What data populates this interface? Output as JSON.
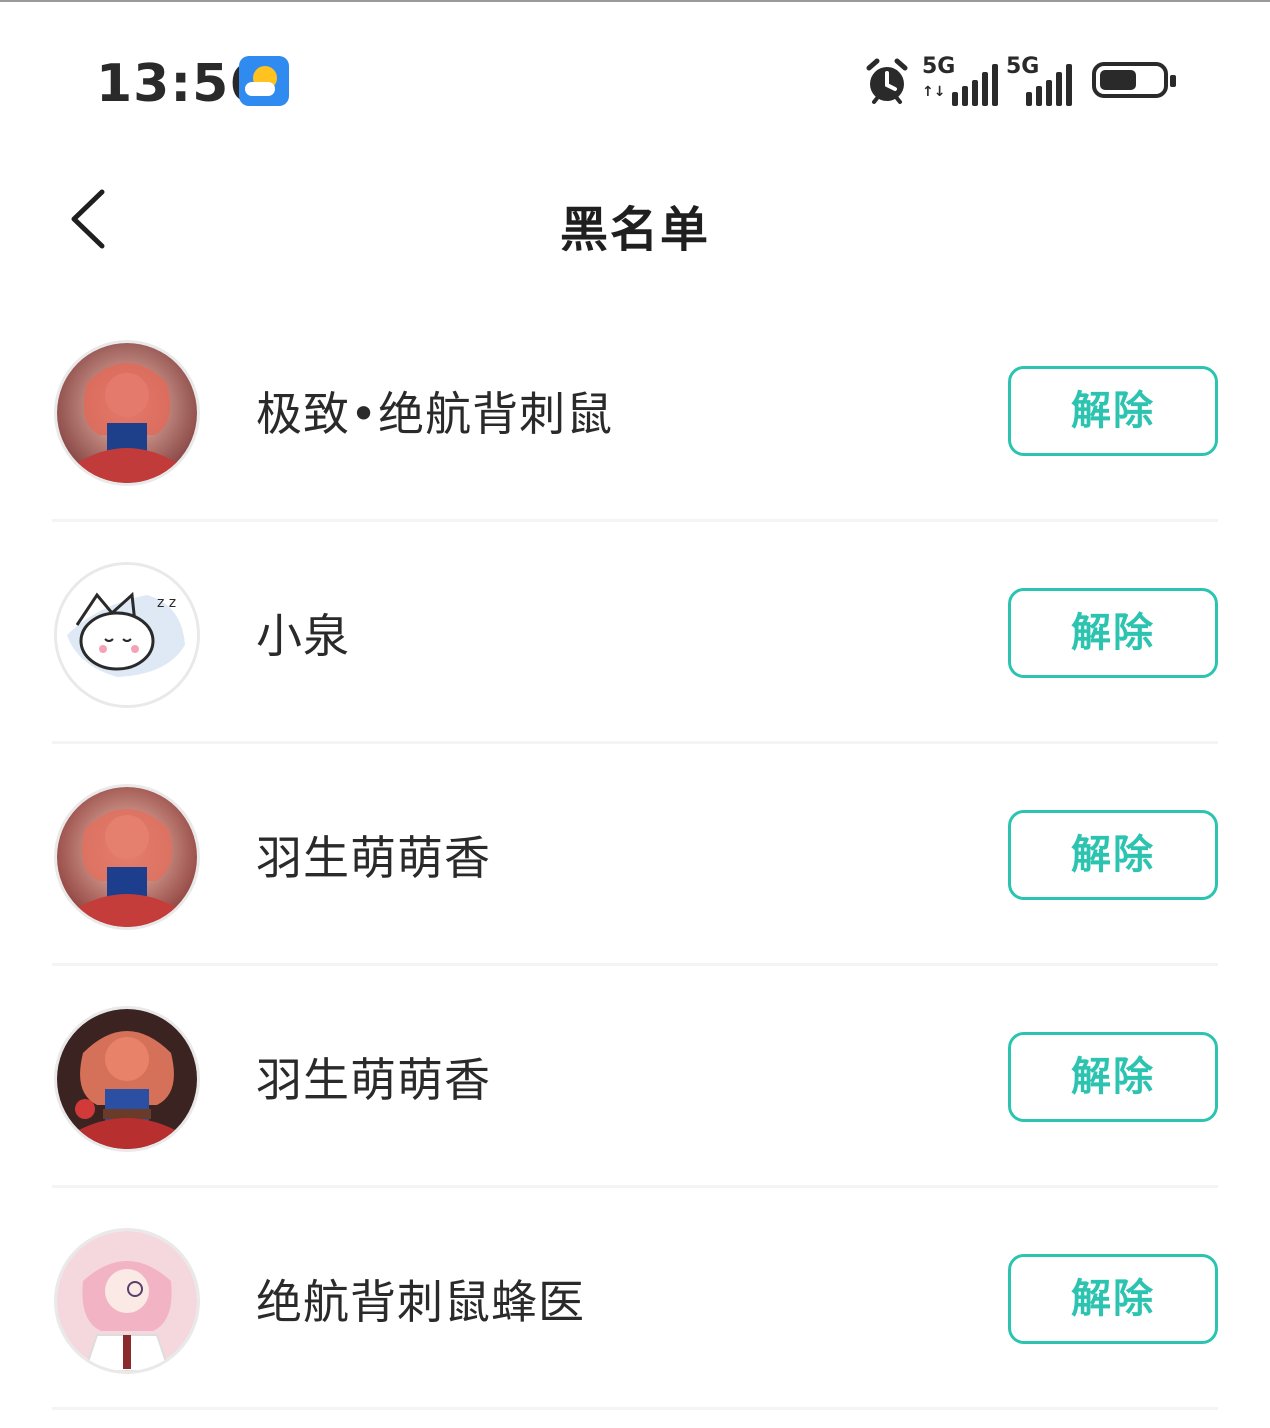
{
  "status_bar": {
    "time": "13:56",
    "network_1": "5G",
    "network_2": "5G",
    "battery_level": 0.6,
    "icons": [
      "weather-icon",
      "alarm-icon",
      "signal-icon",
      "battery-icon"
    ]
  },
  "header": {
    "title": "黑名单",
    "back_icon": "chevron-left-icon"
  },
  "blocked_users": [
    {
      "name": "极致•绝航背刺鼠",
      "action_label": "解除",
      "avatar": "anime-avatar-red-hair"
    },
    {
      "name": "小泉",
      "action_label": "解除",
      "avatar": "sleeping-cat-avatar"
    },
    {
      "name": "羽生萌萌香",
      "action_label": "解除",
      "avatar": "anime-avatar-red-hair"
    },
    {
      "name": "羽生萌萌香",
      "action_label": "解除",
      "avatar": "anime-avatar-dark-bg"
    },
    {
      "name": "绝航背刺鼠蜂医",
      "action_label": "解除",
      "avatar": "anime-avatar-pink-hair"
    }
  ],
  "colors": {
    "accent": "#2cc4b0",
    "text": "#2a2a2a",
    "divider": "#f2f4f6"
  }
}
